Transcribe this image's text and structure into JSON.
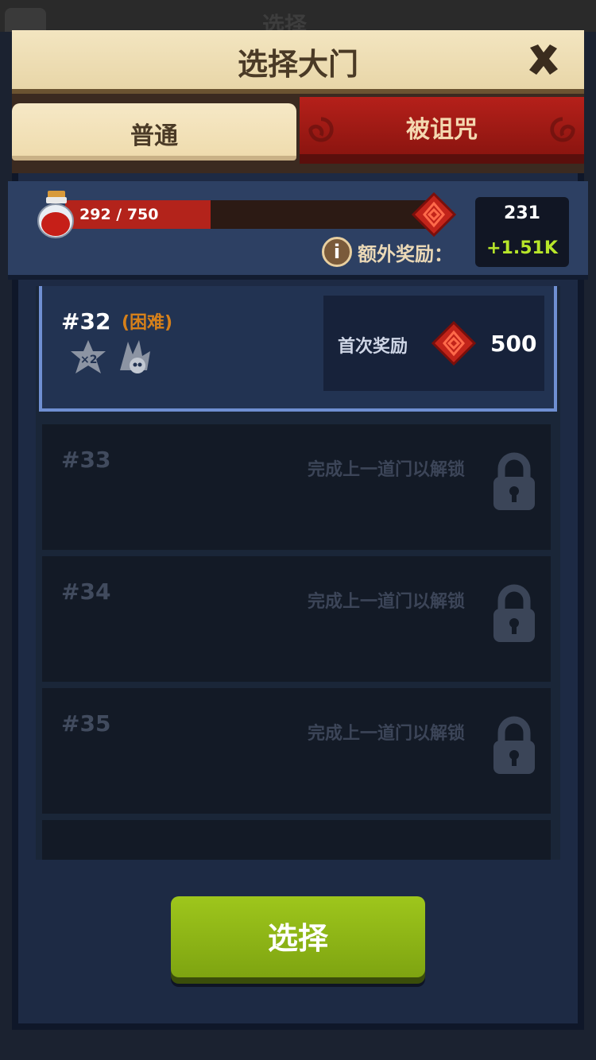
{
  "background_title": "选择",
  "header": {
    "title": "选择大门"
  },
  "tabs": [
    {
      "label": "普通",
      "active": true
    },
    {
      "label": "被诅咒",
      "active": false
    }
  ],
  "progress": {
    "text": "292 / 750",
    "current": 292,
    "max": 750
  },
  "bonus": {
    "label": "额外奖励：",
    "total": "231",
    "plus": "+1.51K"
  },
  "doors": [
    {
      "number": "#32",
      "difficulty": "(困难)",
      "state": "selected",
      "reward_label": "首次奖励",
      "reward_value": "500"
    },
    {
      "number": "#33",
      "state": "locked",
      "lock_text": "完成上一道门以解锁"
    },
    {
      "number": "#34",
      "state": "locked",
      "lock_text": "完成上一道门以解锁"
    },
    {
      "number": "#35",
      "state": "locked",
      "lock_text": "完成上一道门以解锁"
    }
  ],
  "select_button": "选择",
  "colors": {
    "accent_green": "#8fb816",
    "cursed_red": "#a81c16",
    "parchment": "#efdcae"
  }
}
